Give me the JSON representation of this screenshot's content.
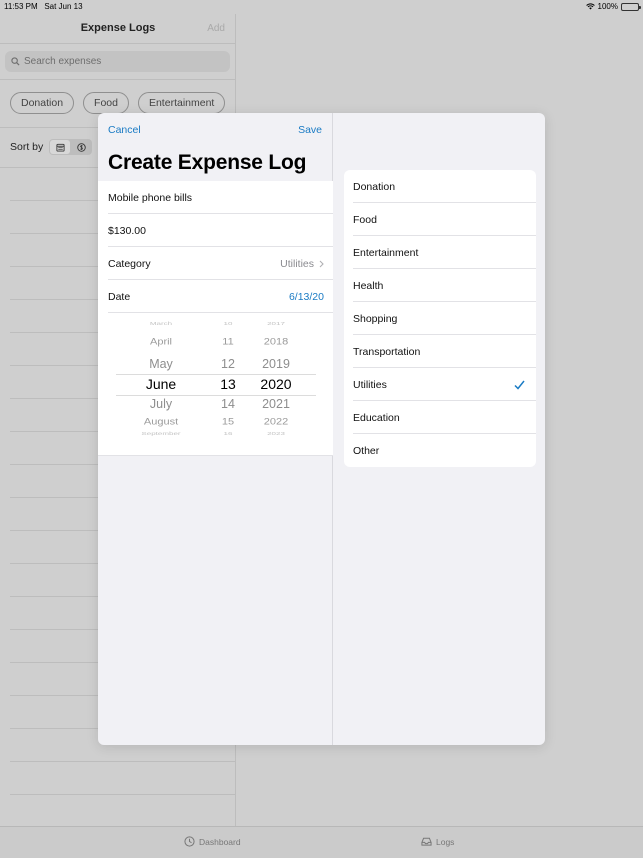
{
  "status": {
    "time": "11:53 PM",
    "date": "Sat Jun 13",
    "battery": "100%"
  },
  "list_pane": {
    "title": "Expense Logs",
    "add_label": "Add",
    "search_placeholder": "Search expenses",
    "chips": [
      "Donation",
      "Food",
      "Entertainment"
    ],
    "sort_label": "Sort by"
  },
  "modal": {
    "cancel_label": "Cancel",
    "save_label": "Save",
    "title": "Create Expense Log",
    "name_value": "Mobile phone bills",
    "amount_value": "$130.00",
    "category_label": "Category",
    "category_value": "Utilities",
    "date_label": "Date",
    "date_value": "6/13/20",
    "date_picker": {
      "months": [
        "March",
        "April",
        "May",
        "June",
        "July",
        "August",
        "September"
      ],
      "days": [
        "10",
        "11",
        "12",
        "13",
        "14",
        "15",
        "16"
      ],
      "years": [
        "2017",
        "2018",
        "2019",
        "2020",
        "2021",
        "2022",
        "2023"
      ],
      "selected_index": 3
    }
  },
  "categories": {
    "items": [
      "Donation",
      "Food",
      "Entertainment",
      "Health",
      "Shopping",
      "Transportation",
      "Utilities",
      "Education",
      "Other"
    ],
    "selected": "Utilities"
  },
  "tabbar": {
    "dashboard_label": "Dashboard",
    "logs_label": "Logs"
  },
  "colors": {
    "accent": "#1a7bc4"
  },
  "icons": [
    "search-icon",
    "calendar-icon",
    "dollar-icon",
    "chevron-right-icon",
    "checkmark-icon",
    "clock-icon",
    "tray-icon",
    "wifi-icon",
    "battery-icon"
  ]
}
